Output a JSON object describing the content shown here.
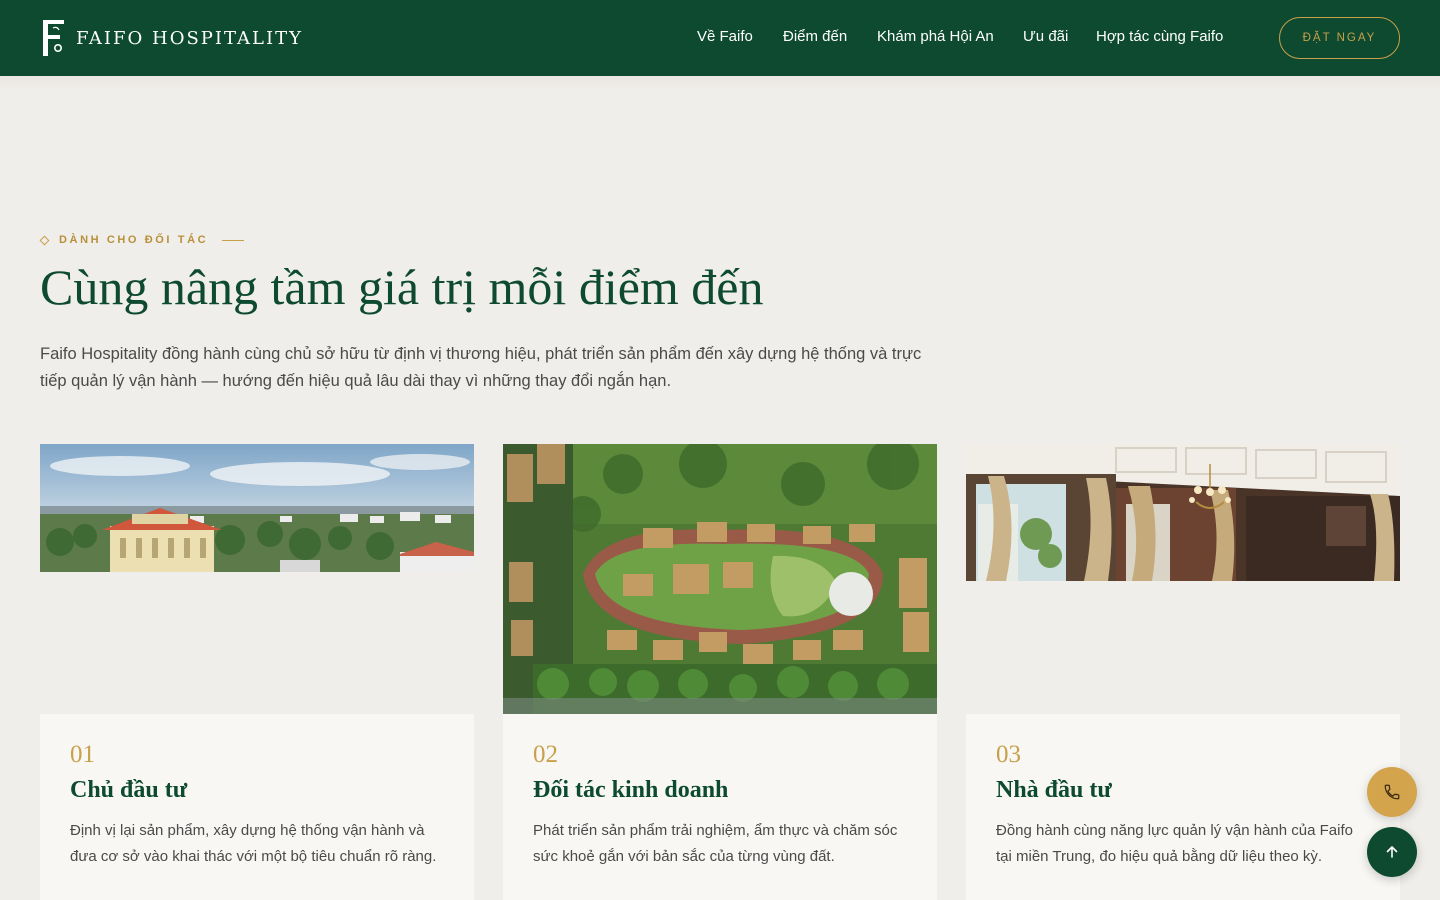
{
  "brand": {
    "name": "FAIFO HOSPITALITY"
  },
  "nav": {
    "items": [
      {
        "label": "Về Faifo"
      },
      {
        "label": "Điểm đến"
      },
      {
        "label": "Khám phá Hội An"
      },
      {
        "label": "Ưu đãi"
      },
      {
        "label": "Hợp tác cùng Faifo"
      }
    ],
    "cta_label": "ĐẶT NGAY"
  },
  "intro": {
    "eyebrow": "DÀNH CHO ĐỐI TÁC",
    "title": "Cùng nâng tầm giá trị mỗi điểm đến",
    "lede": "Faifo Hospitality đồng hành cùng chủ sở hữu từ định vị thương hiệu, phát triển sản phẩm đến xây dựng hệ thống và trực tiếp quản lý vận hành — hướng đến hiệu quả lâu dài thay vì những thay đổi ngắn hạn."
  },
  "cards": [
    {
      "number": "01",
      "title": "Chủ đầu tư",
      "description": "Định vị lại sản phẩm, xây dựng hệ thống vận hành và đưa cơ sở vào khai thác với một bộ tiêu chuẩn rõ ràng."
    },
    {
      "number": "02",
      "title": "Đối tác kinh doanh",
      "description": "Phát triển sản phẩm trải nghiệm, ẩm thực và chăm sóc sức khoẻ gắn với bản sắc của từng vùng đất."
    },
    {
      "number": "03",
      "title": "Nhà đầu tư",
      "description": "Đồng hành cùng năng lực quản lý vận hành của Faifo tại miền Trung, đo hiệu quả bằng dữ liệu theo kỳ."
    }
  ],
  "floating": {
    "call_icon": "phone-icon",
    "top_icon": "arrow-up-icon"
  },
  "colors": {
    "brand_green": "#0d4a30",
    "gold": "#c8a04a",
    "background": "#f0eeea"
  }
}
